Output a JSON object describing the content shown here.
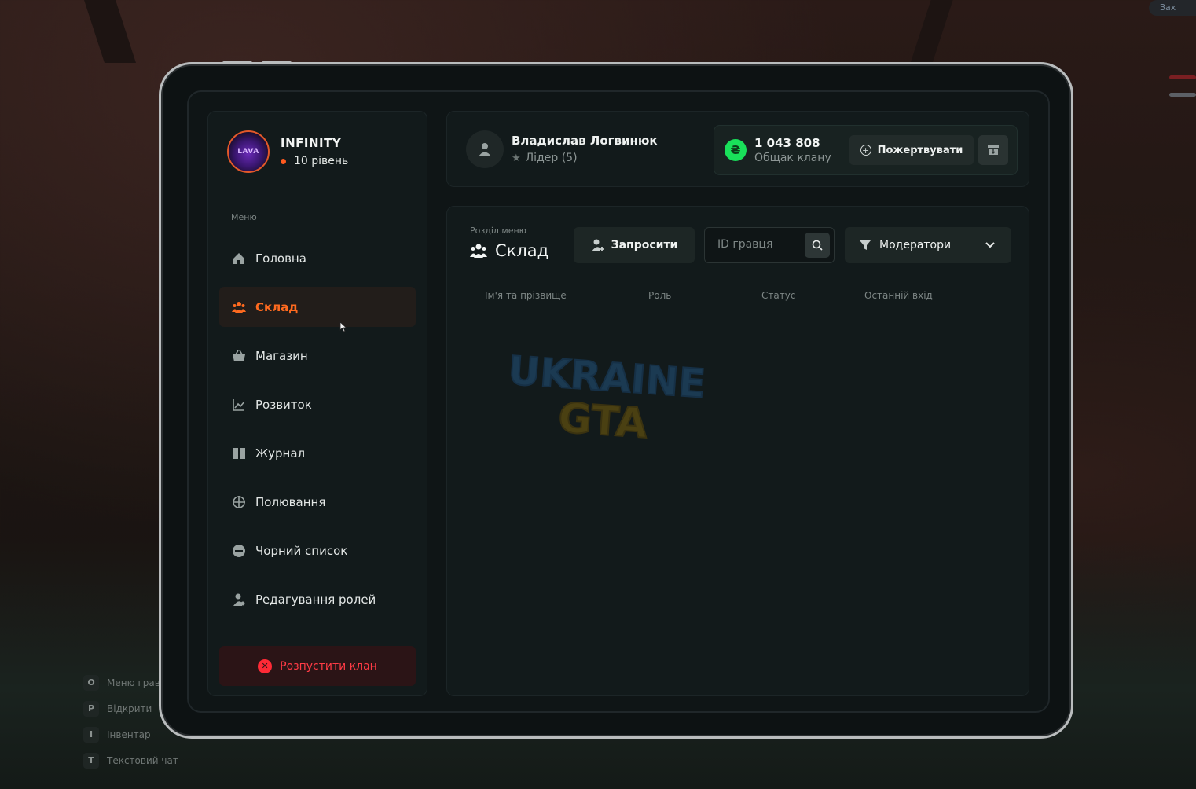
{
  "clan": {
    "name": "INFINITY",
    "level": "10 рівень",
    "logo_text": "LAVA"
  },
  "menu": {
    "caption": "Меню",
    "items": [
      {
        "label": "Головна",
        "icon": "home-icon"
      },
      {
        "label": "Склад",
        "icon": "users-icon",
        "active": true
      },
      {
        "label": "Магазин",
        "icon": "basket-icon"
      },
      {
        "label": "Розвиток",
        "icon": "chart-icon"
      },
      {
        "label": "Журнал",
        "icon": "book-icon"
      },
      {
        "label": "Полювання",
        "icon": "crosshair-icon"
      },
      {
        "label": "Чорний список",
        "icon": "minus-circle-icon"
      },
      {
        "label": "Редагування ролей",
        "icon": "user-gear-icon"
      }
    ],
    "disband_label": "Розпустити клан"
  },
  "user": {
    "name": "Владислав Логвинюк",
    "role": "Лідер (5)"
  },
  "wallet": {
    "amount": "1 043 808",
    "label": "Общак клану",
    "currency_icon": "hryvnia-icon",
    "donate_label": "Пожертвувати"
  },
  "section": {
    "caption": "Розділ меню",
    "title": "Склад",
    "invite_label": "Запросити",
    "search_placeholder": "ID гравця",
    "filter_selected": "Модератори"
  },
  "table": {
    "columns": [
      "Ім'я та прізвище",
      "Роль",
      "Статус",
      "Останній вхід"
    ],
    "rows": []
  },
  "hud": {
    "hints": [
      {
        "key": "O",
        "text": "Меню гравця"
      },
      {
        "key": "P",
        "text": "Відкрити"
      },
      {
        "key": "I",
        "text": "Інвентар"
      },
      {
        "key": "T",
        "text": "Текстовий чат"
      }
    ],
    "corner_label": "Зах"
  },
  "colors": {
    "accent": "#ff6a1f",
    "danger": "#ff3b45",
    "money": "#19e05a"
  }
}
